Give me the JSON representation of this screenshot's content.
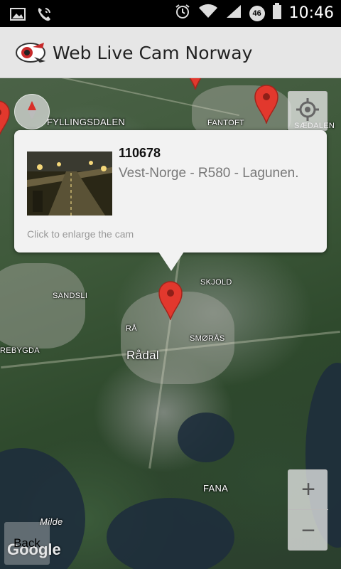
{
  "status_bar": {
    "time": "10:46",
    "network_badge": "46",
    "left_icons": [
      "image-icon",
      "phone-icon"
    ],
    "right_icons": [
      "alarm-icon",
      "wifi-icon",
      "signal-icon",
      "battery-icon"
    ]
  },
  "app_bar": {
    "title": "Web Live Cam Norway",
    "logo_icon": "app-logo-icon"
  },
  "map": {
    "place_labels": [
      {
        "name": "fyllingsdalen",
        "text": "FYLLINGSDALEN"
      },
      {
        "name": "fantoft",
        "text": "FANTOFT"
      },
      {
        "name": "saedalen",
        "text": "SÆDALEN"
      },
      {
        "name": "skjold",
        "text": "SKJOLD"
      },
      {
        "name": "sandsli",
        "text": "SANDSLI"
      },
      {
        "name": "ra",
        "text": "RÅ"
      },
      {
        "name": "smoras",
        "text": "SMØRÅS"
      },
      {
        "name": "rebygda",
        "text": "REBYGDA"
      },
      {
        "name": "radal",
        "text": "Rådal"
      },
      {
        "name": "fana",
        "text": "FANA"
      },
      {
        "name": "milde",
        "text": "Milde"
      }
    ],
    "controls": {
      "zoom_in": "+",
      "zoom_out": "−",
      "back": "Back",
      "attribution": "Google"
    }
  },
  "info_window": {
    "cam_id": "110678",
    "location": "Vest-Norge - R580 - Lagunen.",
    "hint": "Click to enlarge the cam"
  },
  "colors": {
    "marker": "#e2382d",
    "action_bar": "#e6e6e6",
    "status_bar": "#000000"
  }
}
